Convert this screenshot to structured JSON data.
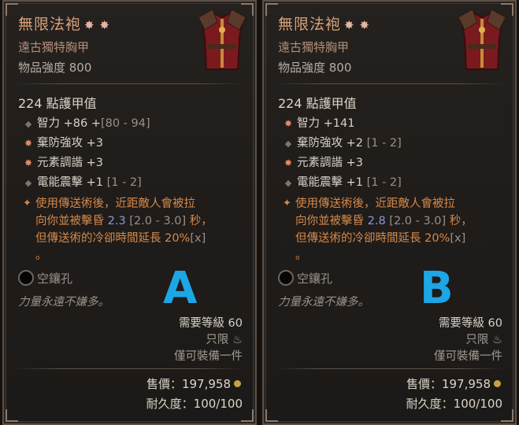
{
  "panels": [
    {
      "id": "a",
      "name": "無限法袍",
      "stars": "✸ ✸",
      "type": "遠古獨特胸甲",
      "power": "物品強度 800",
      "armor": "224 點護甲值",
      "affixes": [
        {
          "bullet": "dot",
          "text": "智力 +86 +",
          "range": "[80 - 94]"
        },
        {
          "bullet": "star",
          "text": "棄防強攻 +3",
          "range": ""
        },
        {
          "bullet": "star",
          "text": "元素調諧 +3",
          "range": ""
        },
        {
          "bullet": "dot",
          "text": "電能震擊 +1 ",
          "range": "[1 - 2]"
        }
      ],
      "legendary": {
        "line1": "使用傳送術後，近距敵人會被拉",
        "line2a": "向你並被擊昏 ",
        "value": "2.3",
        "range": " [2.0 - 3.0]",
        "line2b": " 秒，",
        "line3a": "但傳送術的冷卻時間延長 20%",
        "line3b": "[x]",
        "line4": "。"
      },
      "socket": "空鑲孔",
      "flavor": "力量永遠不嫌多。",
      "level_req": "需要等級 60",
      "only": "只限",
      "equip_limit": "僅可裝備一件",
      "price": "售價：197,958",
      "durability": "耐久度：100/100",
      "letter": "A"
    },
    {
      "id": "b",
      "name": "無限法袍",
      "stars": "✸ ✸",
      "type": "遠古獨特胸甲",
      "power": "物品強度 800",
      "armor": "224 點護甲值",
      "affixes": [
        {
          "bullet": "star",
          "text": "智力 +141",
          "range": ""
        },
        {
          "bullet": "dot",
          "text": "棄防強攻 +2 ",
          "range": "[1 - 2]"
        },
        {
          "bullet": "star",
          "text": "元素調諧 +3",
          "range": ""
        },
        {
          "bullet": "dot",
          "text": "電能震擊 +1 ",
          "range": "[1 - 2]"
        }
      ],
      "legendary": {
        "line1": "使用傳送術後，近距敵人會被拉",
        "line2a": "向你並被擊昏 ",
        "value": "2.8",
        "range": " [2.0 - 3.0]",
        "line2b": " 秒，",
        "line3a": "但傳送術的冷卻時間延長 20%",
        "line3b": "[x]",
        "line4": "。"
      },
      "socket": "空鑲孔",
      "flavor": "力量永遠不嫌多。",
      "level_req": "需要等級 60",
      "only": "只限",
      "equip_limit": "僅可裝備一件",
      "price": "售價：197,958",
      "durability": "耐久度：100/100",
      "letter": "B"
    }
  ],
  "colors": {
    "title": "#d7a27a",
    "legendary": "#d6894a",
    "highlight_value": "#8a99e6",
    "letter": "#1da6e6"
  },
  "icons": {
    "armor": "red-chest-armor-icon",
    "star_bullet": "star-bullet-icon",
    "dot_bullet": "diamond-bullet-icon",
    "socket": "empty-socket-icon",
    "coin": "gold-coin-icon",
    "class": "sorcerer-class-icon"
  }
}
